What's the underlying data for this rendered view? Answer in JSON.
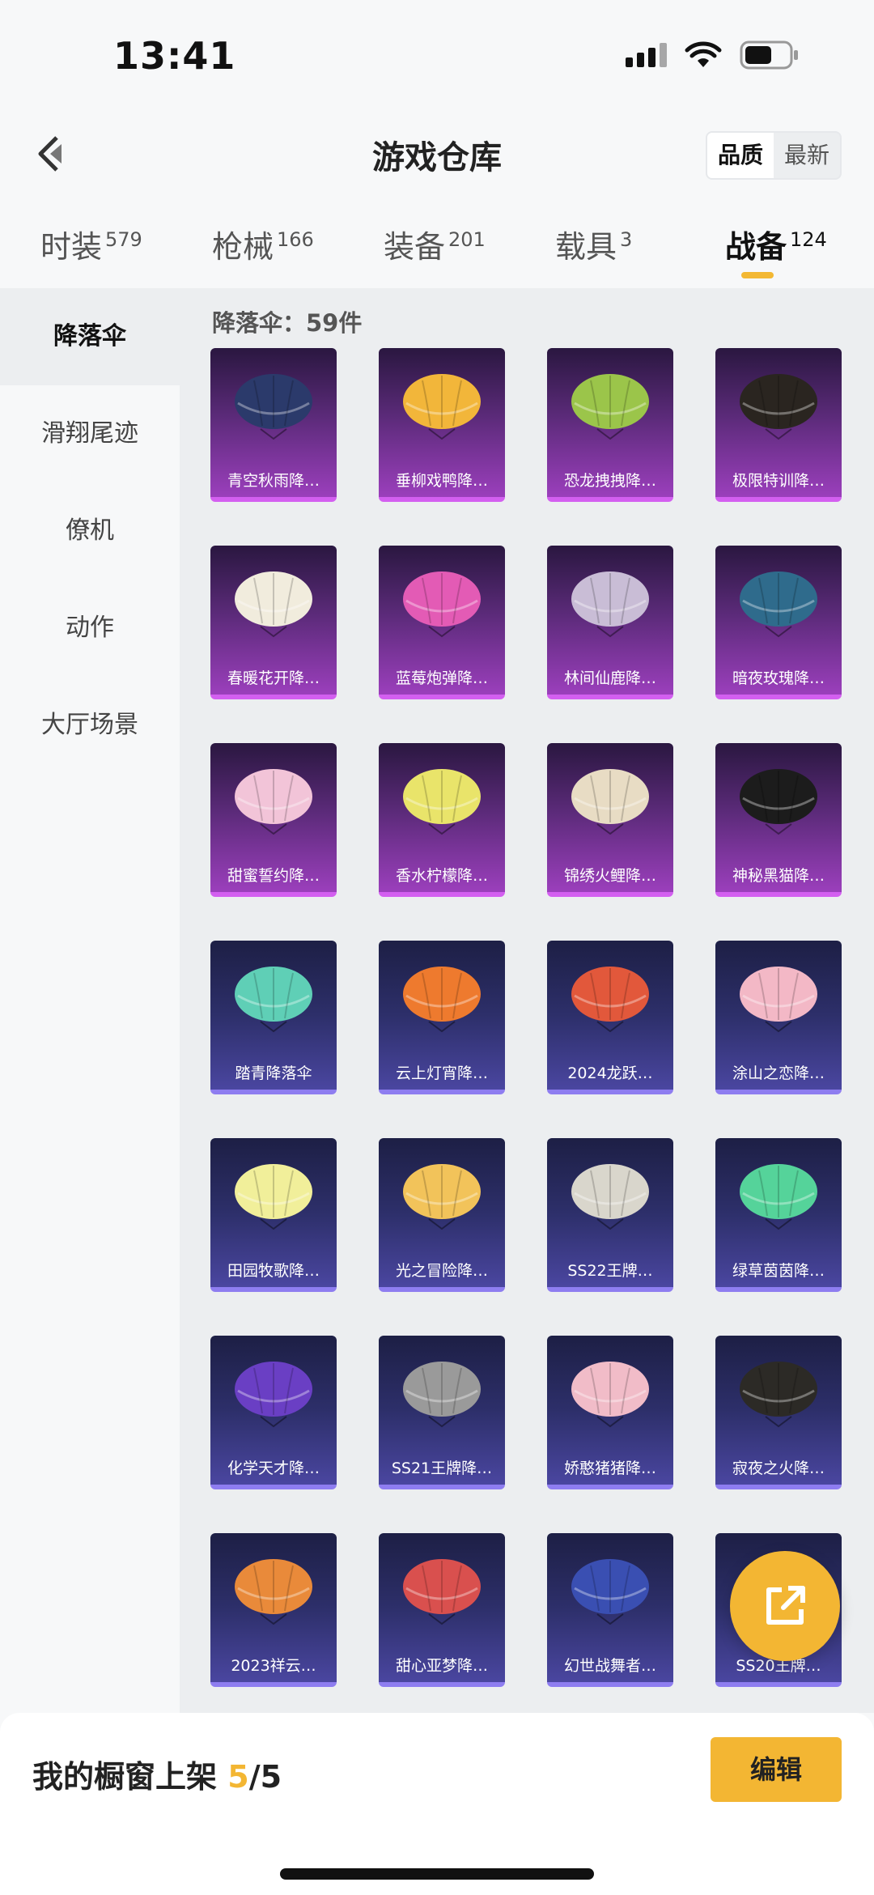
{
  "status_bar": {
    "time": "13:41"
  },
  "header": {
    "title": "游戏仓库",
    "sort_options": [
      "品质",
      "最新"
    ]
  },
  "tabs": [
    {
      "label": "时装",
      "count": "579"
    },
    {
      "label": "枪械",
      "count": "166"
    },
    {
      "label": "装备",
      "count": "201"
    },
    {
      "label": "载具",
      "count": "3"
    },
    {
      "label": "战备",
      "count": "124"
    }
  ],
  "sidebar": {
    "items": [
      "降落伞",
      "滑翔尾迹",
      "僚机",
      "动作",
      "大厅场景"
    ]
  },
  "content": {
    "count_label": "降落伞：59件",
    "items": [
      {
        "name": "青空秋雨降…",
        "rarity": "purple",
        "color": "#2b3a6b"
      },
      {
        "name": "垂柳戏鸭降…",
        "rarity": "purple",
        "color": "#f2b63a"
      },
      {
        "name": "恐龙拽拽降…",
        "rarity": "purple",
        "color": "#9bc54a"
      },
      {
        "name": "极限特训降…",
        "rarity": "purple",
        "color": "#2a2520"
      },
      {
        "name": "春暖花开降…",
        "rarity": "purple",
        "color": "#f1ecdd"
      },
      {
        "name": "蓝莓炮弹降…",
        "rarity": "purple",
        "color": "#e35bb5"
      },
      {
        "name": "林间仙鹿降…",
        "rarity": "purple",
        "color": "#c9bdd6"
      },
      {
        "name": "暗夜玫瑰降…",
        "rarity": "purple",
        "color": "#2f6b8c"
      },
      {
        "name": "甜蜜誓约降…",
        "rarity": "purple",
        "color": "#f2c4d8"
      },
      {
        "name": "香水柠檬降…",
        "rarity": "purple",
        "color": "#e9e46a"
      },
      {
        "name": "锦绣火鲤降…",
        "rarity": "purple",
        "color": "#e8dcc4"
      },
      {
        "name": "神秘黑猫降…",
        "rarity": "purple",
        "color": "#1c1c1c"
      },
      {
        "name": "踏青降落伞",
        "rarity": "blue",
        "color": "#5fcfb6"
      },
      {
        "name": "云上灯宵降…",
        "rarity": "blue",
        "color": "#ee7a2e"
      },
      {
        "name": "2024龙跃…",
        "rarity": "blue",
        "color": "#e2583b"
      },
      {
        "name": "涂山之恋降…",
        "rarity": "blue",
        "color": "#f3b8c6"
      },
      {
        "name": "田园牧歌降…",
        "rarity": "blue",
        "color": "#f1ef9a"
      },
      {
        "name": "光之冒险降…",
        "rarity": "blue",
        "color": "#f2c35a"
      },
      {
        "name": "SS22王牌…",
        "rarity": "blue",
        "color": "#d9d6cc"
      },
      {
        "name": "绿草茵茵降…",
        "rarity": "blue",
        "color": "#55d39a"
      },
      {
        "name": "化学天才降…",
        "rarity": "blue",
        "color": "#6a3fc4"
      },
      {
        "name": "SS21王牌降…",
        "rarity": "blue",
        "color": "#9a9a9a"
      },
      {
        "name": "娇憨猪猪降…",
        "rarity": "blue",
        "color": "#f1bcc8"
      },
      {
        "name": "寂夜之火降…",
        "rarity": "blue",
        "color": "#2c2a26"
      },
      {
        "name": "2023祥云…",
        "rarity": "blue",
        "color": "#e98a3a"
      },
      {
        "name": "甜心亚梦降…",
        "rarity": "blue",
        "color": "#d9504e"
      },
      {
        "name": "幻世战舞者…",
        "rarity": "blue",
        "color": "#3a4fb2"
      },
      {
        "name": "SS20王牌…",
        "rarity": "blue",
        "color": "#c6c6c6"
      }
    ]
  },
  "bottom_bar": {
    "shelf_label": "我的橱窗上架",
    "current": "5",
    "separator": "/",
    "total": "5",
    "edit_label": "编辑"
  },
  "colors": {
    "accent": "#f3b633",
    "purple_rarity": "#d35ff0",
    "blue_rarity": "#8e7df0"
  }
}
